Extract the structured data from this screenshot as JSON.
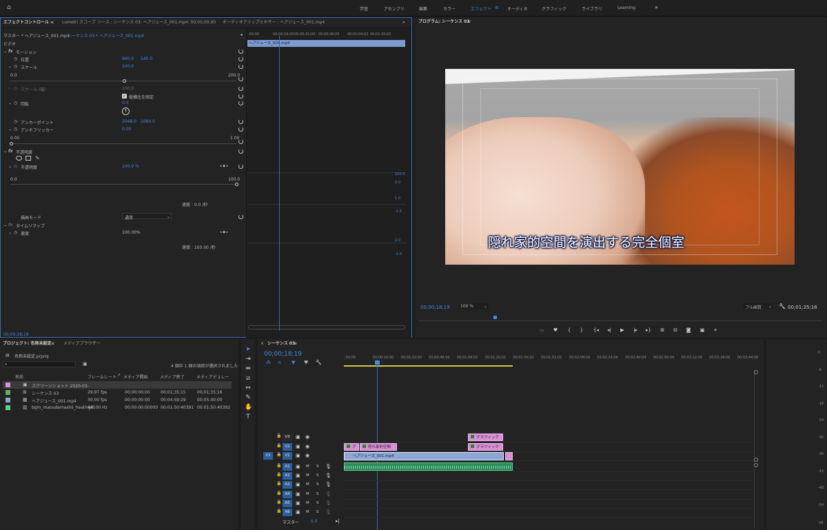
{
  "topbar": {
    "tabs": [
      "学習",
      "アセンブリ",
      "編集",
      "カラー",
      "エフェクト",
      "オーディオ",
      "グラフィック",
      "ライブラリ",
      "Learning"
    ],
    "active_tab": "エフェクト",
    "more": "»"
  },
  "effect_panel": {
    "tabs": [
      "エフェクトコントロール",
      "Lumetri スコープ",
      "ソース : シーケンス 03: ヘアジュース_001.mp4: 00;00;00;00",
      "オーディオクリップミキサー : ヘアジュース_001.mp4"
    ],
    "master_label": "マスター * ヘアジュース_001.mp4",
    "seq_label": "シーケンス 03 * ヘアジュース_001.mp4",
    "section_video": "ビデオ",
    "motion": "モーション",
    "position_label": "位置",
    "position_x": "960.0",
    "position_y": "540.0",
    "scale_label": "スケール",
    "scale_value": "100.0",
    "scale_min": "0.0",
    "scale_max": "200.0",
    "scale_w_label": "スケール (幅)",
    "scale_w_value": "100.0",
    "uniform_scale": "縦横比を固定",
    "rotation_label": "回転",
    "rotation_value": "0.0",
    "anchor_label": "アンカーポイント",
    "anchor_x": "2048.0",
    "anchor_y": "1080.0",
    "flicker_label": "アンチフリッカー",
    "flicker_value": "0.00",
    "flicker_min": "0.00",
    "flicker_max": "1.00",
    "opacity_section": "不透明度",
    "opacity_label": "不透明度",
    "opacity_value": "100.0 %",
    "opacity_min": "0.0",
    "opacity_max": "100.0",
    "speed_text1": "速度 : 0.0 /秒",
    "blend_label": "描画モード",
    "blend_value": "通常",
    "time_remap": "タイムリマップ",
    "speed_label": "速度",
    "speed_value": "100.00%",
    "speed_text2": "速度 : 100.00 /秒",
    "timecode": "00;00;18;19",
    "timeline_ticks": [
      ":00;00",
      "00;00;16;00",
      "00;00;32;00",
      "00;00;48;00",
      "00;01;04;02",
      "00;01;20;02"
    ],
    "clip_name": "ヘアジュース_001.mp4",
    "graph_vals": [
      "100.0",
      "0.0",
      "1.0",
      "-1.0",
      "2.0",
      "-1.0"
    ]
  },
  "program_monitor": {
    "title": "プログラム: シーケンス 03",
    "subtitle": "隠れ家的空間を演出する完全個室",
    "timecode": "00;00;18;19",
    "zoom": "100 %",
    "quality": "フル画質",
    "duration": "00;01;35;16"
  },
  "project_panel": {
    "tabs": [
      "プロジェクト: 名称未設定",
      "メディアブラウザー"
    ],
    "file": "名称未設定.prproj",
    "search_placeholder": "",
    "count_text": "4 個中 1 個の項目が選択されました",
    "columns": [
      "名前",
      "フレームレート",
      "メディア開始",
      "メディア終了",
      "メディアデュレー"
    ],
    "rows": [
      {
        "name": "スクリーンショット 2020-03-",
        "fps": "",
        "start": "",
        "end": "",
        "dur": "",
        "color": "#d98fd6",
        "selected": true
      },
      {
        "name": "シーケンス 03",
        "fps": "29.97 fps",
        "start": "00;00;00;00",
        "end": "00;01;35;15",
        "dur": "00;01;35;16",
        "color": "#5fb35a",
        "selected": false
      },
      {
        "name": "ヘアジュース_001.mp4",
        "fps": "30.00 fps",
        "start": "00:00:00:00",
        "end": "00:04:59:29",
        "dur": "00:05:00:00",
        "color": "#8aa7d8",
        "selected": false
      },
      {
        "name": "bgm_maoudamashii_healing0",
        "fps": "44100 Hz",
        "start": "00:00:00:00000",
        "end": "00:01:50:40391",
        "dur": "00:01:50:40392",
        "color": "#5fcf8c",
        "selected": false
      }
    ]
  },
  "timeline": {
    "title": "シーケンス 03",
    "timecode": "00;00;18;19",
    "ticks": [
      ";00;00",
      "00;00;16;00",
      "00;00;32;00",
      "00;00;48;00",
      "00;01;04;02",
      "00;01;20;02",
      "00;01;36;02",
      "00;01;52;02",
      "00;02;08;04",
      "00;02;24;04",
      "00;02;40;04",
      "00;02;56;04",
      "00;03;12;06",
      "00;03;28;06",
      "00;03;44;06"
    ],
    "video_tracks": [
      "V3",
      "V2",
      "V1"
    ],
    "audio_tracks": [
      "A1",
      "A2",
      "A3",
      "A4",
      "A5",
      "A6"
    ],
    "src_v1": "V1",
    "master": "マスター",
    "master_value": "0.0",
    "clip_v1": "ヘアジュース_001.mp4",
    "clip_v2a": "グ",
    "clip_v2b": "隠れ家的空間",
    "clip_v2c": "グラフィック",
    "clip_v3": "グラフィック",
    "m": "M",
    "s": "S",
    "meter_ticks": [
      "0",
      "-6",
      "-12",
      "-18",
      "-24",
      "-30",
      "-36",
      "-42",
      "-48",
      "-54"
    ],
    "meter_db": "dB"
  }
}
